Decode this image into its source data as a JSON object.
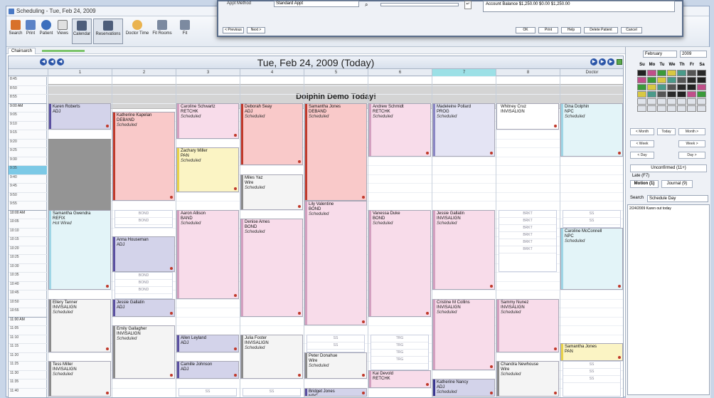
{
  "window": {
    "title": "Scheduling - Tue, Feb 24, 2009"
  },
  "toolbar": {
    "items": [
      {
        "label": "Search"
      },
      {
        "label": "Print"
      },
      {
        "label": "Patient"
      },
      {
        "label": "Views"
      },
      {
        "label": "Calendar"
      },
      {
        "label": "Reservations"
      },
      {
        "label": "Doctor Time"
      },
      {
        "label": "Fit Rooms"
      },
      {
        "label": "Fit"
      }
    ]
  },
  "tabs": {
    "active": "Chairsarch"
  },
  "schedule": {
    "date_title": "Tue, Feb 24, 2009 (Today)",
    "columns": [
      "1",
      "2",
      "3",
      "4",
      "5",
      "6",
      "7",
      "8",
      "Doctor"
    ],
    "highlight_column": 6,
    "banner": "Dolphin Demo Today!",
    "times": [
      "8:45",
      "8:50",
      "8:55",
      "9:00 AM",
      "9:05",
      "9:10",
      "9:15",
      "9:20",
      "9:25",
      "9:30",
      "9:35",
      "9:40",
      "9:45",
      "9:50",
      "9:55",
      "10:00 AM",
      "10:05",
      "10:10",
      "10:15",
      "10:20",
      "10:25",
      "10:30",
      "10:35",
      "10:40",
      "10:45",
      "10:50",
      "10:55",
      "11:00 AM",
      "11:05",
      "11:10",
      "11:15",
      "11:20",
      "11:25",
      "11:30",
      "11:35",
      "11:40"
    ],
    "current_time_index": 10
  },
  "appointments": [
    {
      "col": 0,
      "r0": 3,
      "r1": 6,
      "name": "Karen Roberts",
      "proc": "ADJ",
      "status": "",
      "color": "#d3d3ea",
      "bar": "#5a4fa0"
    },
    {
      "col": 0,
      "r0": 15,
      "r1": 24,
      "name": "Samantha Gwendra",
      "proc": "REFIX",
      "status": "Hot Wired",
      "color": "#e3f4f8",
      "bar": "#9fd6e6"
    },
    {
      "col": 0,
      "r0": 25,
      "r1": 31,
      "name": "Ellery Tanner",
      "proc": "INVISALIGN",
      "status": "Scheduled",
      "color": "#f4f4f4",
      "bar": "#8a8a8a"
    },
    {
      "col": 0,
      "r0": 32,
      "r1": 36,
      "name": "Tess Miller",
      "proc": "INVISALIGN",
      "status": "Scheduled",
      "color": "#f4f4f4",
      "bar": "#8a8a8a"
    },
    {
      "col": 1,
      "r0": 4,
      "r1": 14,
      "name": "Katherine Kapelan",
      "proc": "DEBAND",
      "status": "Scheduled",
      "color": "#f9c9c9",
      "bar": "#c0392b"
    },
    {
      "col": 1,
      "r0": 18,
      "r1": 22,
      "name": "Anna Houseman",
      "proc": "ADJ",
      "status": "",
      "color": "#d3d3ea",
      "bar": "#5a4fa0"
    },
    {
      "col": 1,
      "r0": 25,
      "r1": 27,
      "name": "Jessie Gallatin",
      "proc": "ADJ",
      "status": "",
      "color": "#d3d3ea",
      "bar": "#5a4fa0"
    },
    {
      "col": 1,
      "r0": 28,
      "r1": 34,
      "name": "Emily Gallagher",
      "proc": "INVISALIGN",
      "status": "Scheduled",
      "color": "#f4f4f4",
      "bar": "#8a8a8a"
    },
    {
      "col": 2,
      "r0": 3,
      "r1": 7,
      "name": "Caroline Schwartz",
      "proc": "RETCHK",
      "status": "Scheduled",
      "color": "#f8dcea",
      "bar": "#d4a0c0"
    },
    {
      "col": 2,
      "r0": 8,
      "r1": 13,
      "name": "Zachary Miller",
      "proc": "PAN",
      "status": "Scheduled",
      "color": "#fbf4c4",
      "bar": "#e8d24a"
    },
    {
      "col": 2,
      "r0": 15,
      "r1": 25,
      "name": "Aaron Allison",
      "proc": "BAND",
      "status": "Scheduled",
      "color": "#f8dcea",
      "bar": "#d4a0c0"
    },
    {
      "col": 2,
      "r0": 29,
      "r1": 31,
      "name": "Allen Leyland",
      "proc": "ADJ",
      "status": "",
      "color": "#d3d3ea",
      "bar": "#5a4fa0"
    },
    {
      "col": 2,
      "r0": 32,
      "r1": 34,
      "name": "Camille Johnson",
      "proc": "ADJ",
      "status": "",
      "color": "#d3d3ea",
      "bar": "#5a4fa0"
    },
    {
      "col": 3,
      "r0": 3,
      "r1": 10,
      "name": "Deborah Seay",
      "proc": "ADJ",
      "status": "Scheduled",
      "color": "#f9c9c9",
      "bar": "#c0392b"
    },
    {
      "col": 3,
      "r0": 11,
      "r1": 15,
      "name": "Miles Yaz",
      "proc": "Wire",
      "status": "Scheduled",
      "color": "#f4f4f4",
      "bar": "#8a8a8a"
    },
    {
      "col": 3,
      "r0": 16,
      "r1": 27,
      "name": "Denise Ames",
      "proc": "BOND",
      "status": "Scheduled",
      "color": "#f8dcea",
      "bar": "#d4a0c0"
    },
    {
      "col": 3,
      "r0": 29,
      "r1": 34,
      "name": "Julia Foster",
      "proc": "INVISALIGN",
      "status": "Scheduled",
      "color": "#f4f4f4",
      "bar": "#8a8a8a"
    },
    {
      "col": 4,
      "r0": 3,
      "r1": 14,
      "name": "Samantha Jones",
      "proc": "DEBAND",
      "status": "Scheduled",
      "color": "#f9c9c9",
      "bar": "#c0392b"
    },
    {
      "col": 4,
      "r0": 14,
      "r1": 28,
      "name": "Lily Valentine",
      "proc": "BOND",
      "status": "Scheduled",
      "color": "#f8dcea",
      "bar": "#d4a0c0"
    },
    {
      "col": 4,
      "r0": 31,
      "r1": 34,
      "name": "Peter Donahue",
      "proc": "Wire",
      "status": "Scheduled",
      "color": "#f4f4f4",
      "bar": "#8a8a8a"
    },
    {
      "col": 4,
      "r0": 35,
      "r1": 36,
      "name": "Bridget Jones",
      "proc": "NPC",
      "status": "",
      "color": "#d3d3ea",
      "bar": "#5a4fa0"
    },
    {
      "col": 5,
      "r0": 3,
      "r1": 9,
      "name": "Andrew Schmidt",
      "proc": "RETCHK",
      "status": "Scheduled",
      "color": "#f8dcea",
      "bar": "#d4a0c0"
    },
    {
      "col": 5,
      "r0": 15,
      "r1": 27,
      "name": "Vanessa Duke",
      "proc": "BOND",
      "status": "Scheduled",
      "color": "#f8dcea",
      "bar": "#d4a0c0"
    },
    {
      "col": 5,
      "r0": 33,
      "r1": 35,
      "name": "Kai Devold",
      "proc": "RETCHK",
      "status": "",
      "color": "#f8dcea",
      "bar": "#d4a0c0"
    },
    {
      "col": 6,
      "r0": 3,
      "r1": 9,
      "name": "Madeleine Pollard",
      "proc": "PROG",
      "status": "Scheduled",
      "color": "#e4e4f4",
      "bar": "#8a86c4"
    },
    {
      "col": 6,
      "r0": 15,
      "r1": 24,
      "name": "Jessie Gallatin",
      "proc": "INVISALIGN",
      "status": "Scheduled",
      "color": "#f8dcea",
      "bar": "#d4a0c0"
    },
    {
      "col": 6,
      "r0": 25,
      "r1": 33,
      "name": "Cristine M Collins",
      "proc": "INVISALIGN",
      "status": "Scheduled",
      "color": "#f8dcea",
      "bar": "#d4a0c0"
    },
    {
      "col": 6,
      "r0": 34,
      "r1": 36,
      "name": "Katherine Nancy",
      "proc": "ADJ",
      "status": "Scheduled",
      "color": "#d3d3ea",
      "bar": "#3a3690"
    },
    {
      "col": 7,
      "r0": 3,
      "r1": 6,
      "name": "Whitney Cruz",
      "proc": "INVISALIGN",
      "status": "",
      "color": "#ffffff",
      "bar": "#ffffff"
    },
    {
      "col": 7,
      "r0": 25,
      "r1": 31,
      "name": "Sammy Nunez",
      "proc": "INVISALIGN",
      "status": "Scheduled",
      "color": "#f8dcea",
      "bar": "#d4a0c0"
    },
    {
      "col": 7,
      "r0": 32,
      "r1": 36,
      "name": "Chandra Newhouse",
      "proc": "Wire",
      "status": "Scheduled",
      "color": "#f4f4f4",
      "bar": "#8a8a8a"
    },
    {
      "col": 8,
      "r0": 3,
      "r1": 9,
      "name": "Dina Dolphin",
      "proc": "NPC",
      "status": "Scheduled",
      "color": "#e3f4f8",
      "bar": "#9fd6e6"
    },
    {
      "col": 8,
      "r0": 17,
      "r1": 24,
      "name": "Caroline McConnell",
      "proc": "NPC",
      "status": "Scheduled",
      "color": "#e3f4f8",
      "bar": "#9fd6e6"
    },
    {
      "col": 8,
      "r0": 30,
      "r1": 32,
      "name": "Samantha Jones",
      "proc": "PAN",
      "status": "",
      "color": "#fbf4c4",
      "bar": "#e8d24a"
    }
  ],
  "slots": [
    {
      "col": 1,
      "r0": 15,
      "r1": 17,
      "labels": [
        "BOND",
        "BOND"
      ]
    },
    {
      "col": 1,
      "r0": 22,
      "r1": 25,
      "labels": [
        "BOND",
        "BOND",
        "BOND"
      ]
    },
    {
      "col": 2,
      "r0": 35,
      "r1": 36,
      "labels": [
        "SS"
      ]
    },
    {
      "col": 3,
      "r0": 35,
      "r1": 36,
      "labels": [
        "SS"
      ]
    },
    {
      "col": 4,
      "r0": 29,
      "r1": 31,
      "labels": [
        "SS",
        "SS"
      ]
    },
    {
      "col": 5,
      "r0": 29,
      "r1": 33,
      "labels": [
        "TRG",
        "TRG",
        "TRG",
        "TRG"
      ]
    },
    {
      "col": 7,
      "r0": 15,
      "r1": 22,
      "labels": [
        "BRKT",
        "BRKT",
        "BRKT",
        "BRKT",
        "BRKT",
        "BRKT"
      ]
    },
    {
      "col": 8,
      "r0": 15,
      "r1": 17,
      "labels": [
        "SS",
        "SS"
      ]
    },
    {
      "col": 8,
      "r0": 32,
      "r1": 36,
      "labels": [
        "SS",
        "SS",
        "SS"
      ]
    }
  ],
  "gray_blocks": [
    {
      "col": 0,
      "r0": 7,
      "r1": 15
    }
  ],
  "right_panel": {
    "month": "February",
    "year": "2009",
    "dow": [
      "Su",
      "Mo",
      "Tu",
      "We",
      "Th",
      "Fr",
      "Sa"
    ],
    "nav": [
      {
        "label": "< Month"
      },
      {
        "label": "Today"
      },
      {
        "label": "Month >"
      },
      {
        "label": "< Week"
      },
      {
        "label": "Week >"
      },
      {
        "label": "< Day"
      },
      {
        "label": "Day >"
      }
    ],
    "tabs": [
      {
        "label": "Unconfirmed (11+)"
      },
      {
        "label": "Late (F7)"
      },
      {
        "label": "Motion (1)"
      },
      {
        "label": "Journal (9)"
      }
    ],
    "search_label": "Search",
    "search_value": "Schedule Day",
    "note": "2/24/2009 Karen out today"
  },
  "dialog": {
    "field_label": "Appt Method",
    "field_value": "Standard Appt",
    "info": "Account Balance  $1,250.00   $0.00  $1,250.00",
    "buttons": [
      {
        "label": "< Previous"
      },
      {
        "label": "Next >"
      },
      {
        "label": "OK"
      },
      {
        "label": "Print"
      },
      {
        "label": "Help"
      },
      {
        "label": "Delete Patient"
      },
      {
        "label": "Cancel"
      }
    ]
  }
}
